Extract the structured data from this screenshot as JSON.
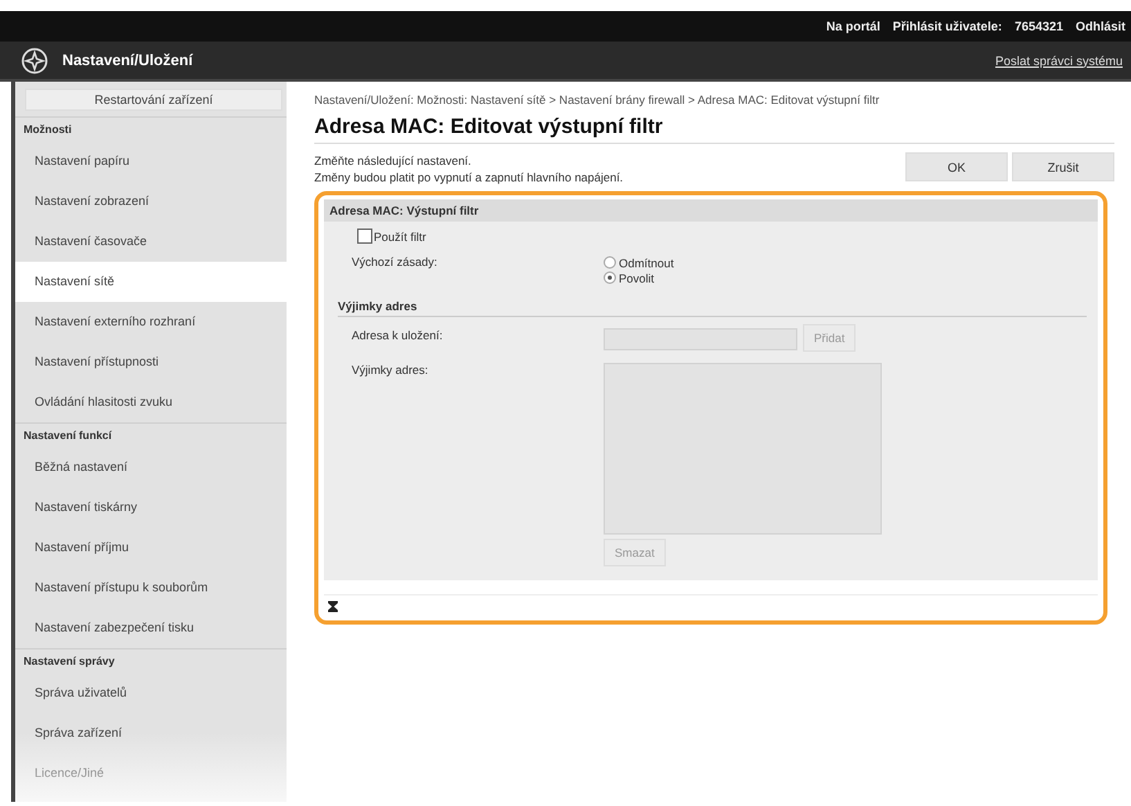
{
  "top_bar": {
    "links": [
      "Na portál",
      "Přihlásit uživatele:",
      "7654321",
      "Odhlásit"
    ]
  },
  "header": {
    "title": "Nastavení/Uložení",
    "link": "Poslat správci systému"
  },
  "sidebar": {
    "restart_button": "Restartování zařízení",
    "sections": [
      {
        "heading": "Možnosti",
        "items": [
          {
            "label": "Nastavení papíru",
            "selected": false
          },
          {
            "label": "Nastavení zobrazení",
            "selected": false
          },
          {
            "label": "Nastavení časovače",
            "selected": false
          },
          {
            "label": "Nastavení sítě",
            "selected": true
          },
          {
            "label": "Nastavení externího rozhraní",
            "selected": false
          },
          {
            "label": "Nastavení přístupnosti",
            "selected": false
          },
          {
            "label": "Ovládání hlasitosti zvuku",
            "selected": false
          }
        ]
      },
      {
        "heading": "Nastavení funkcí",
        "items": [
          {
            "label": "Běžná nastavení",
            "selected": false
          },
          {
            "label": "Nastavení tiskárny",
            "selected": false
          },
          {
            "label": "Nastavení příjmu",
            "selected": false
          },
          {
            "label": "Nastavení přístupu k souborům",
            "selected": false
          },
          {
            "label": "Nastavení zabezpečení tisku",
            "selected": false
          }
        ]
      },
      {
        "heading": "Nastavení správy",
        "items": [
          {
            "label": "Správa uživatelů",
            "selected": false
          },
          {
            "label": "Správa zařízení",
            "selected": false
          },
          {
            "label": "Licence/Jiné",
            "selected": false
          }
        ]
      }
    ]
  },
  "breadcrumb": "Nastavení/Uložení: Možnosti: Nastavení sítě > Nastavení brány firewall > Adresa MAC: Editovat výstupní filtr",
  "page_title": "Adresa MAC: Editovat výstupní filtr",
  "notes": [
    "Změňte následující nastavení.",
    "Změny budou platit po vypnutí a zapnutí hlavního napájení."
  ],
  "buttons": [
    "OK",
    "Zrušit"
  ],
  "panel": {
    "title": "Adresa MAC: Výstupní filtr",
    "use_filter": {
      "label": "Použít filtr",
      "checked": false
    },
    "default_policy": {
      "label": "Výchozí zásady:",
      "options": [
        {
          "label": "Odmítnout",
          "selected": false
        },
        {
          "label": "Povolit",
          "selected": true
        }
      ]
    },
    "exceptions_heading": "Výjimky adres",
    "address_to_store": {
      "label": "Adresa k uložení:",
      "disabled": true,
      "button": "Přidat"
    },
    "exceptions_list": {
      "label": "Výjimky adres:",
      "disabled": true,
      "button": "Smazat"
    }
  }
}
